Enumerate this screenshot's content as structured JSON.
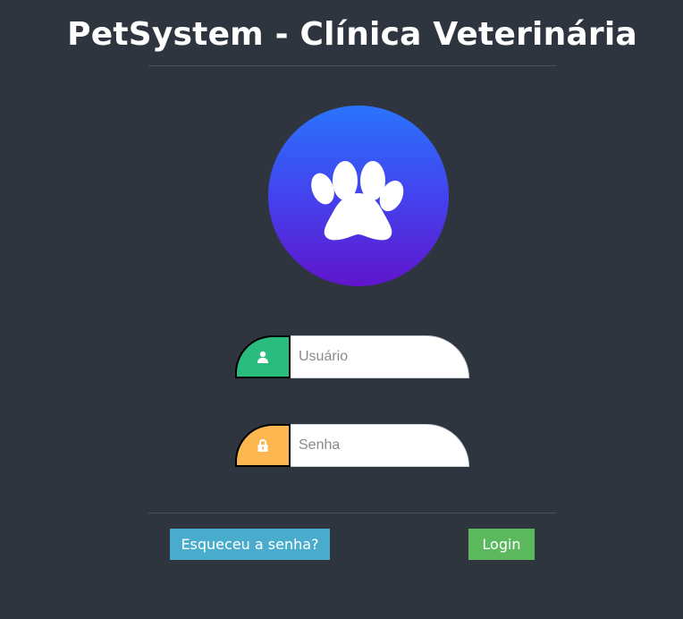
{
  "header": {
    "title": "PetSystem - Clínica Veterinária"
  },
  "logo": {
    "icon": "paw-icon",
    "gradient_colors": [
      "#2a74fd",
      "#6015cc"
    ]
  },
  "form": {
    "username": {
      "icon": "user-icon",
      "placeholder": "Usuário",
      "value": "",
      "addon_color": "#2abb7f"
    },
    "password": {
      "icon": "lock-icon",
      "placeholder": "Senha",
      "value": "",
      "addon_color": "#fdb750"
    }
  },
  "actions": {
    "forgot_label": "Esqueceu a senha?",
    "forgot_color": "#4aaccd",
    "login_label": "Login",
    "login_color": "#5cb85c"
  },
  "theme": {
    "background": "#2e353f"
  }
}
